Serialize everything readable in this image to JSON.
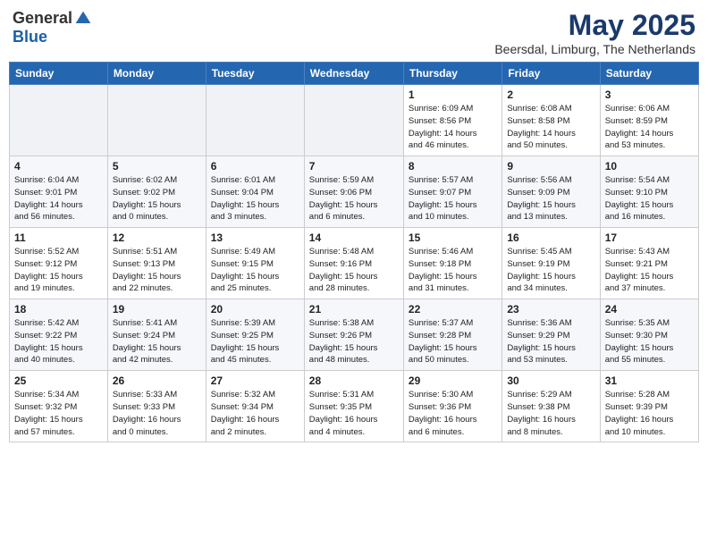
{
  "header": {
    "logo_general": "General",
    "logo_blue": "Blue",
    "month_title": "May 2025",
    "location": "Beersdal, Limburg, The Netherlands"
  },
  "days_of_week": [
    "Sunday",
    "Monday",
    "Tuesday",
    "Wednesday",
    "Thursday",
    "Friday",
    "Saturday"
  ],
  "weeks": [
    [
      {
        "day": "",
        "info": ""
      },
      {
        "day": "",
        "info": ""
      },
      {
        "day": "",
        "info": ""
      },
      {
        "day": "",
        "info": ""
      },
      {
        "day": "1",
        "info": "Sunrise: 6:09 AM\nSunset: 8:56 PM\nDaylight: 14 hours\nand 46 minutes."
      },
      {
        "day": "2",
        "info": "Sunrise: 6:08 AM\nSunset: 8:58 PM\nDaylight: 14 hours\nand 50 minutes."
      },
      {
        "day": "3",
        "info": "Sunrise: 6:06 AM\nSunset: 8:59 PM\nDaylight: 14 hours\nand 53 minutes."
      }
    ],
    [
      {
        "day": "4",
        "info": "Sunrise: 6:04 AM\nSunset: 9:01 PM\nDaylight: 14 hours\nand 56 minutes."
      },
      {
        "day": "5",
        "info": "Sunrise: 6:02 AM\nSunset: 9:02 PM\nDaylight: 15 hours\nand 0 minutes."
      },
      {
        "day": "6",
        "info": "Sunrise: 6:01 AM\nSunset: 9:04 PM\nDaylight: 15 hours\nand 3 minutes."
      },
      {
        "day": "7",
        "info": "Sunrise: 5:59 AM\nSunset: 9:06 PM\nDaylight: 15 hours\nand 6 minutes."
      },
      {
        "day": "8",
        "info": "Sunrise: 5:57 AM\nSunset: 9:07 PM\nDaylight: 15 hours\nand 10 minutes."
      },
      {
        "day": "9",
        "info": "Sunrise: 5:56 AM\nSunset: 9:09 PM\nDaylight: 15 hours\nand 13 minutes."
      },
      {
        "day": "10",
        "info": "Sunrise: 5:54 AM\nSunset: 9:10 PM\nDaylight: 15 hours\nand 16 minutes."
      }
    ],
    [
      {
        "day": "11",
        "info": "Sunrise: 5:52 AM\nSunset: 9:12 PM\nDaylight: 15 hours\nand 19 minutes."
      },
      {
        "day": "12",
        "info": "Sunrise: 5:51 AM\nSunset: 9:13 PM\nDaylight: 15 hours\nand 22 minutes."
      },
      {
        "day": "13",
        "info": "Sunrise: 5:49 AM\nSunset: 9:15 PM\nDaylight: 15 hours\nand 25 minutes."
      },
      {
        "day": "14",
        "info": "Sunrise: 5:48 AM\nSunset: 9:16 PM\nDaylight: 15 hours\nand 28 minutes."
      },
      {
        "day": "15",
        "info": "Sunrise: 5:46 AM\nSunset: 9:18 PM\nDaylight: 15 hours\nand 31 minutes."
      },
      {
        "day": "16",
        "info": "Sunrise: 5:45 AM\nSunset: 9:19 PM\nDaylight: 15 hours\nand 34 minutes."
      },
      {
        "day": "17",
        "info": "Sunrise: 5:43 AM\nSunset: 9:21 PM\nDaylight: 15 hours\nand 37 minutes."
      }
    ],
    [
      {
        "day": "18",
        "info": "Sunrise: 5:42 AM\nSunset: 9:22 PM\nDaylight: 15 hours\nand 40 minutes."
      },
      {
        "day": "19",
        "info": "Sunrise: 5:41 AM\nSunset: 9:24 PM\nDaylight: 15 hours\nand 42 minutes."
      },
      {
        "day": "20",
        "info": "Sunrise: 5:39 AM\nSunset: 9:25 PM\nDaylight: 15 hours\nand 45 minutes."
      },
      {
        "day": "21",
        "info": "Sunrise: 5:38 AM\nSunset: 9:26 PM\nDaylight: 15 hours\nand 48 minutes."
      },
      {
        "day": "22",
        "info": "Sunrise: 5:37 AM\nSunset: 9:28 PM\nDaylight: 15 hours\nand 50 minutes."
      },
      {
        "day": "23",
        "info": "Sunrise: 5:36 AM\nSunset: 9:29 PM\nDaylight: 15 hours\nand 53 minutes."
      },
      {
        "day": "24",
        "info": "Sunrise: 5:35 AM\nSunset: 9:30 PM\nDaylight: 15 hours\nand 55 minutes."
      }
    ],
    [
      {
        "day": "25",
        "info": "Sunrise: 5:34 AM\nSunset: 9:32 PM\nDaylight: 15 hours\nand 57 minutes."
      },
      {
        "day": "26",
        "info": "Sunrise: 5:33 AM\nSunset: 9:33 PM\nDaylight: 16 hours\nand 0 minutes."
      },
      {
        "day": "27",
        "info": "Sunrise: 5:32 AM\nSunset: 9:34 PM\nDaylight: 16 hours\nand 2 minutes."
      },
      {
        "day": "28",
        "info": "Sunrise: 5:31 AM\nSunset: 9:35 PM\nDaylight: 16 hours\nand 4 minutes."
      },
      {
        "day": "29",
        "info": "Sunrise: 5:30 AM\nSunset: 9:36 PM\nDaylight: 16 hours\nand 6 minutes."
      },
      {
        "day": "30",
        "info": "Sunrise: 5:29 AM\nSunset: 9:38 PM\nDaylight: 16 hours\nand 8 minutes."
      },
      {
        "day": "31",
        "info": "Sunrise: 5:28 AM\nSunset: 9:39 PM\nDaylight: 16 hours\nand 10 minutes."
      }
    ]
  ]
}
